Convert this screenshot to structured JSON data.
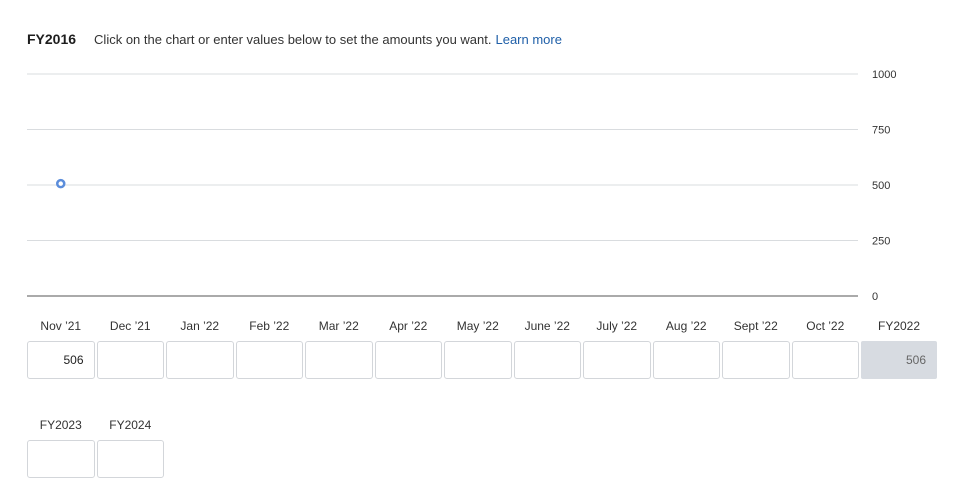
{
  "header": {
    "title": "FY2016",
    "instructions": "Click on the chart or enter values below to set the amounts you want.",
    "learn_more": "Learn more"
  },
  "chart_data": {
    "type": "line",
    "y_ticks": [
      "1000",
      "750",
      "500",
      "250",
      "0"
    ],
    "ylim": [
      0,
      1000
    ],
    "grid": true,
    "categories": [
      "Nov '21",
      "Dec '21",
      "Jan '22",
      "Feb '22",
      "Mar '22",
      "Apr '22",
      "May '22",
      "June '22",
      "July '22",
      "Aug '22",
      "Sept '22",
      "Oct '22"
    ],
    "points": [
      {
        "index": 0,
        "value": 506
      }
    ],
    "colors": {
      "grid": "#d9dcdf",
      "axis": "#555555",
      "point": "#5b8ddb"
    }
  },
  "months": [
    {
      "label": "Nov ’21",
      "value": "506"
    },
    {
      "label": "Dec ’21",
      "value": ""
    },
    {
      "label": "Jan ’22",
      "value": ""
    },
    {
      "label": "Feb ’22",
      "value": ""
    },
    {
      "label": "Mar ’22",
      "value": ""
    },
    {
      "label": "Apr ’22",
      "value": ""
    },
    {
      "label": "May ’22",
      "value": ""
    },
    {
      "label": "June ’22",
      "value": ""
    },
    {
      "label": "July ’22",
      "value": ""
    },
    {
      "label": "Aug ’22",
      "value": ""
    },
    {
      "label": "Sept ’22",
      "value": ""
    },
    {
      "label": "Oct ’22",
      "value": ""
    }
  ],
  "total": {
    "label": "FY2022",
    "value": "506"
  },
  "future_years": [
    {
      "label": "FY2023",
      "value": ""
    },
    {
      "label": "FY2024",
      "value": ""
    }
  ]
}
